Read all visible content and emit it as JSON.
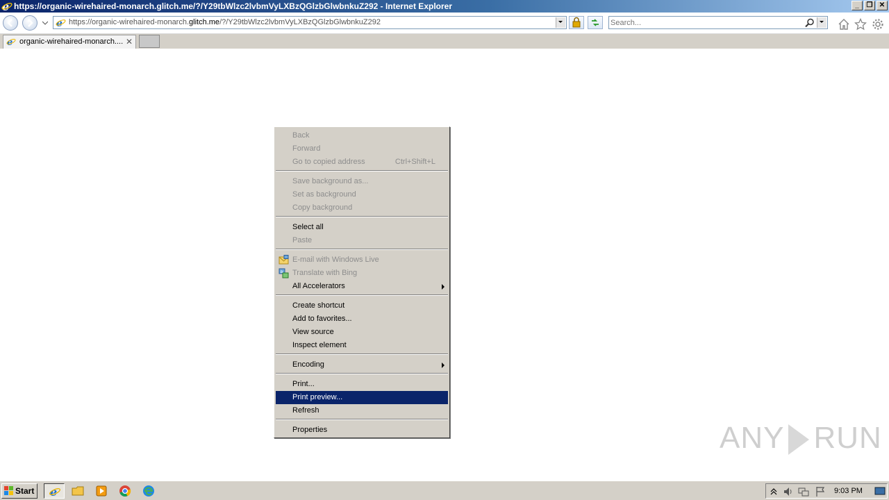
{
  "window": {
    "title": "https://organic-wirehaired-monarch.glitch.me/?/Y29tbWlzc2lvbmVyLXBzQGlzbGlwbnkuZ292 - Internet Explorer"
  },
  "navbar": {
    "url_prefix": "https://organic-wirehaired-monarch.",
    "url_domain": "glitch.me",
    "url_path": "/?/Y29tbWlzc2lvbmVyLXBzQGlzbGlwbnkuZ292",
    "search_placeholder": "Search..."
  },
  "tabs": [
    {
      "label": "organic-wirehaired-monarch...."
    }
  ],
  "context_menu": {
    "back": "Back",
    "forward": "Forward",
    "go_copied": "Go to copied address",
    "go_copied_shortcut": "Ctrl+Shift+L",
    "save_bg": "Save background as...",
    "set_bg": "Set as background",
    "copy_bg": "Copy background",
    "select_all": "Select all",
    "paste": "Paste",
    "email_live": "E-mail with Windows Live",
    "translate_bing": "Translate with Bing",
    "all_accelerators": "All Accelerators",
    "create_shortcut": "Create shortcut",
    "add_favorites": "Add to favorites...",
    "view_source": "View source",
    "inspect_element": "Inspect element",
    "encoding": "Encoding",
    "print": "Print...",
    "print_preview": "Print preview...",
    "refresh": "Refresh",
    "properties": "Properties"
  },
  "watermark": {
    "left": "ANY",
    "right": "RUN"
  },
  "taskbar": {
    "start_label": "Start",
    "clock": "9:03 PM"
  },
  "colors": {
    "menu_highlight": "#0a246a",
    "menu_background": "#d4d0c8",
    "title_gradient_start": "#0a246a"
  }
}
